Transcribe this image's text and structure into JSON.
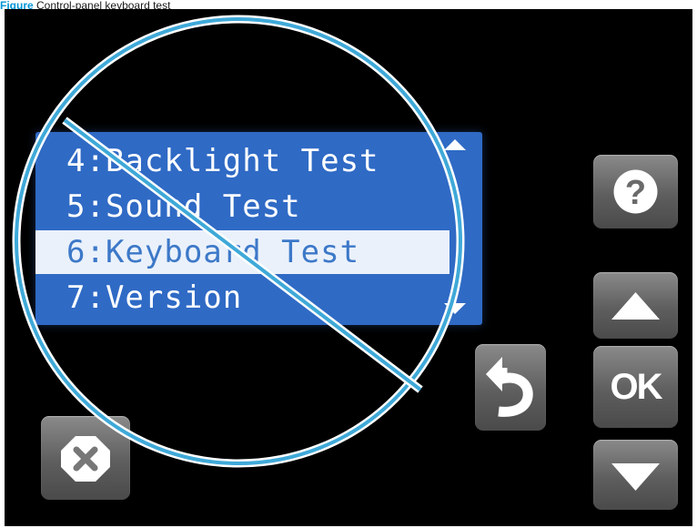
{
  "caption": {
    "figure": "Figure",
    "text": "Control-panel keyboard test"
  },
  "lcd": {
    "items": [
      {
        "label": "4:Backlight Test",
        "selected": false
      },
      {
        "label": "5:Sound Test",
        "selected": false
      },
      {
        "label": "6:Keyboard Test",
        "selected": true
      },
      {
        "label": "7:Version",
        "selected": false
      }
    ],
    "background_color": "#2f6ac5",
    "selected_row_color": "#eaf1fb"
  },
  "buttons": {
    "help": {
      "icon": "question-mark-icon"
    },
    "up": {
      "icon": "arrow-up-icon"
    },
    "ok": {
      "label": "OK"
    },
    "down": {
      "icon": "arrow-down-icon"
    },
    "back": {
      "icon": "back-arrow-icon"
    },
    "cancel": {
      "icon": "cancel-x-icon"
    }
  },
  "overlay": {
    "icon": "prohibited-icon",
    "color": "#3fa9d8"
  }
}
